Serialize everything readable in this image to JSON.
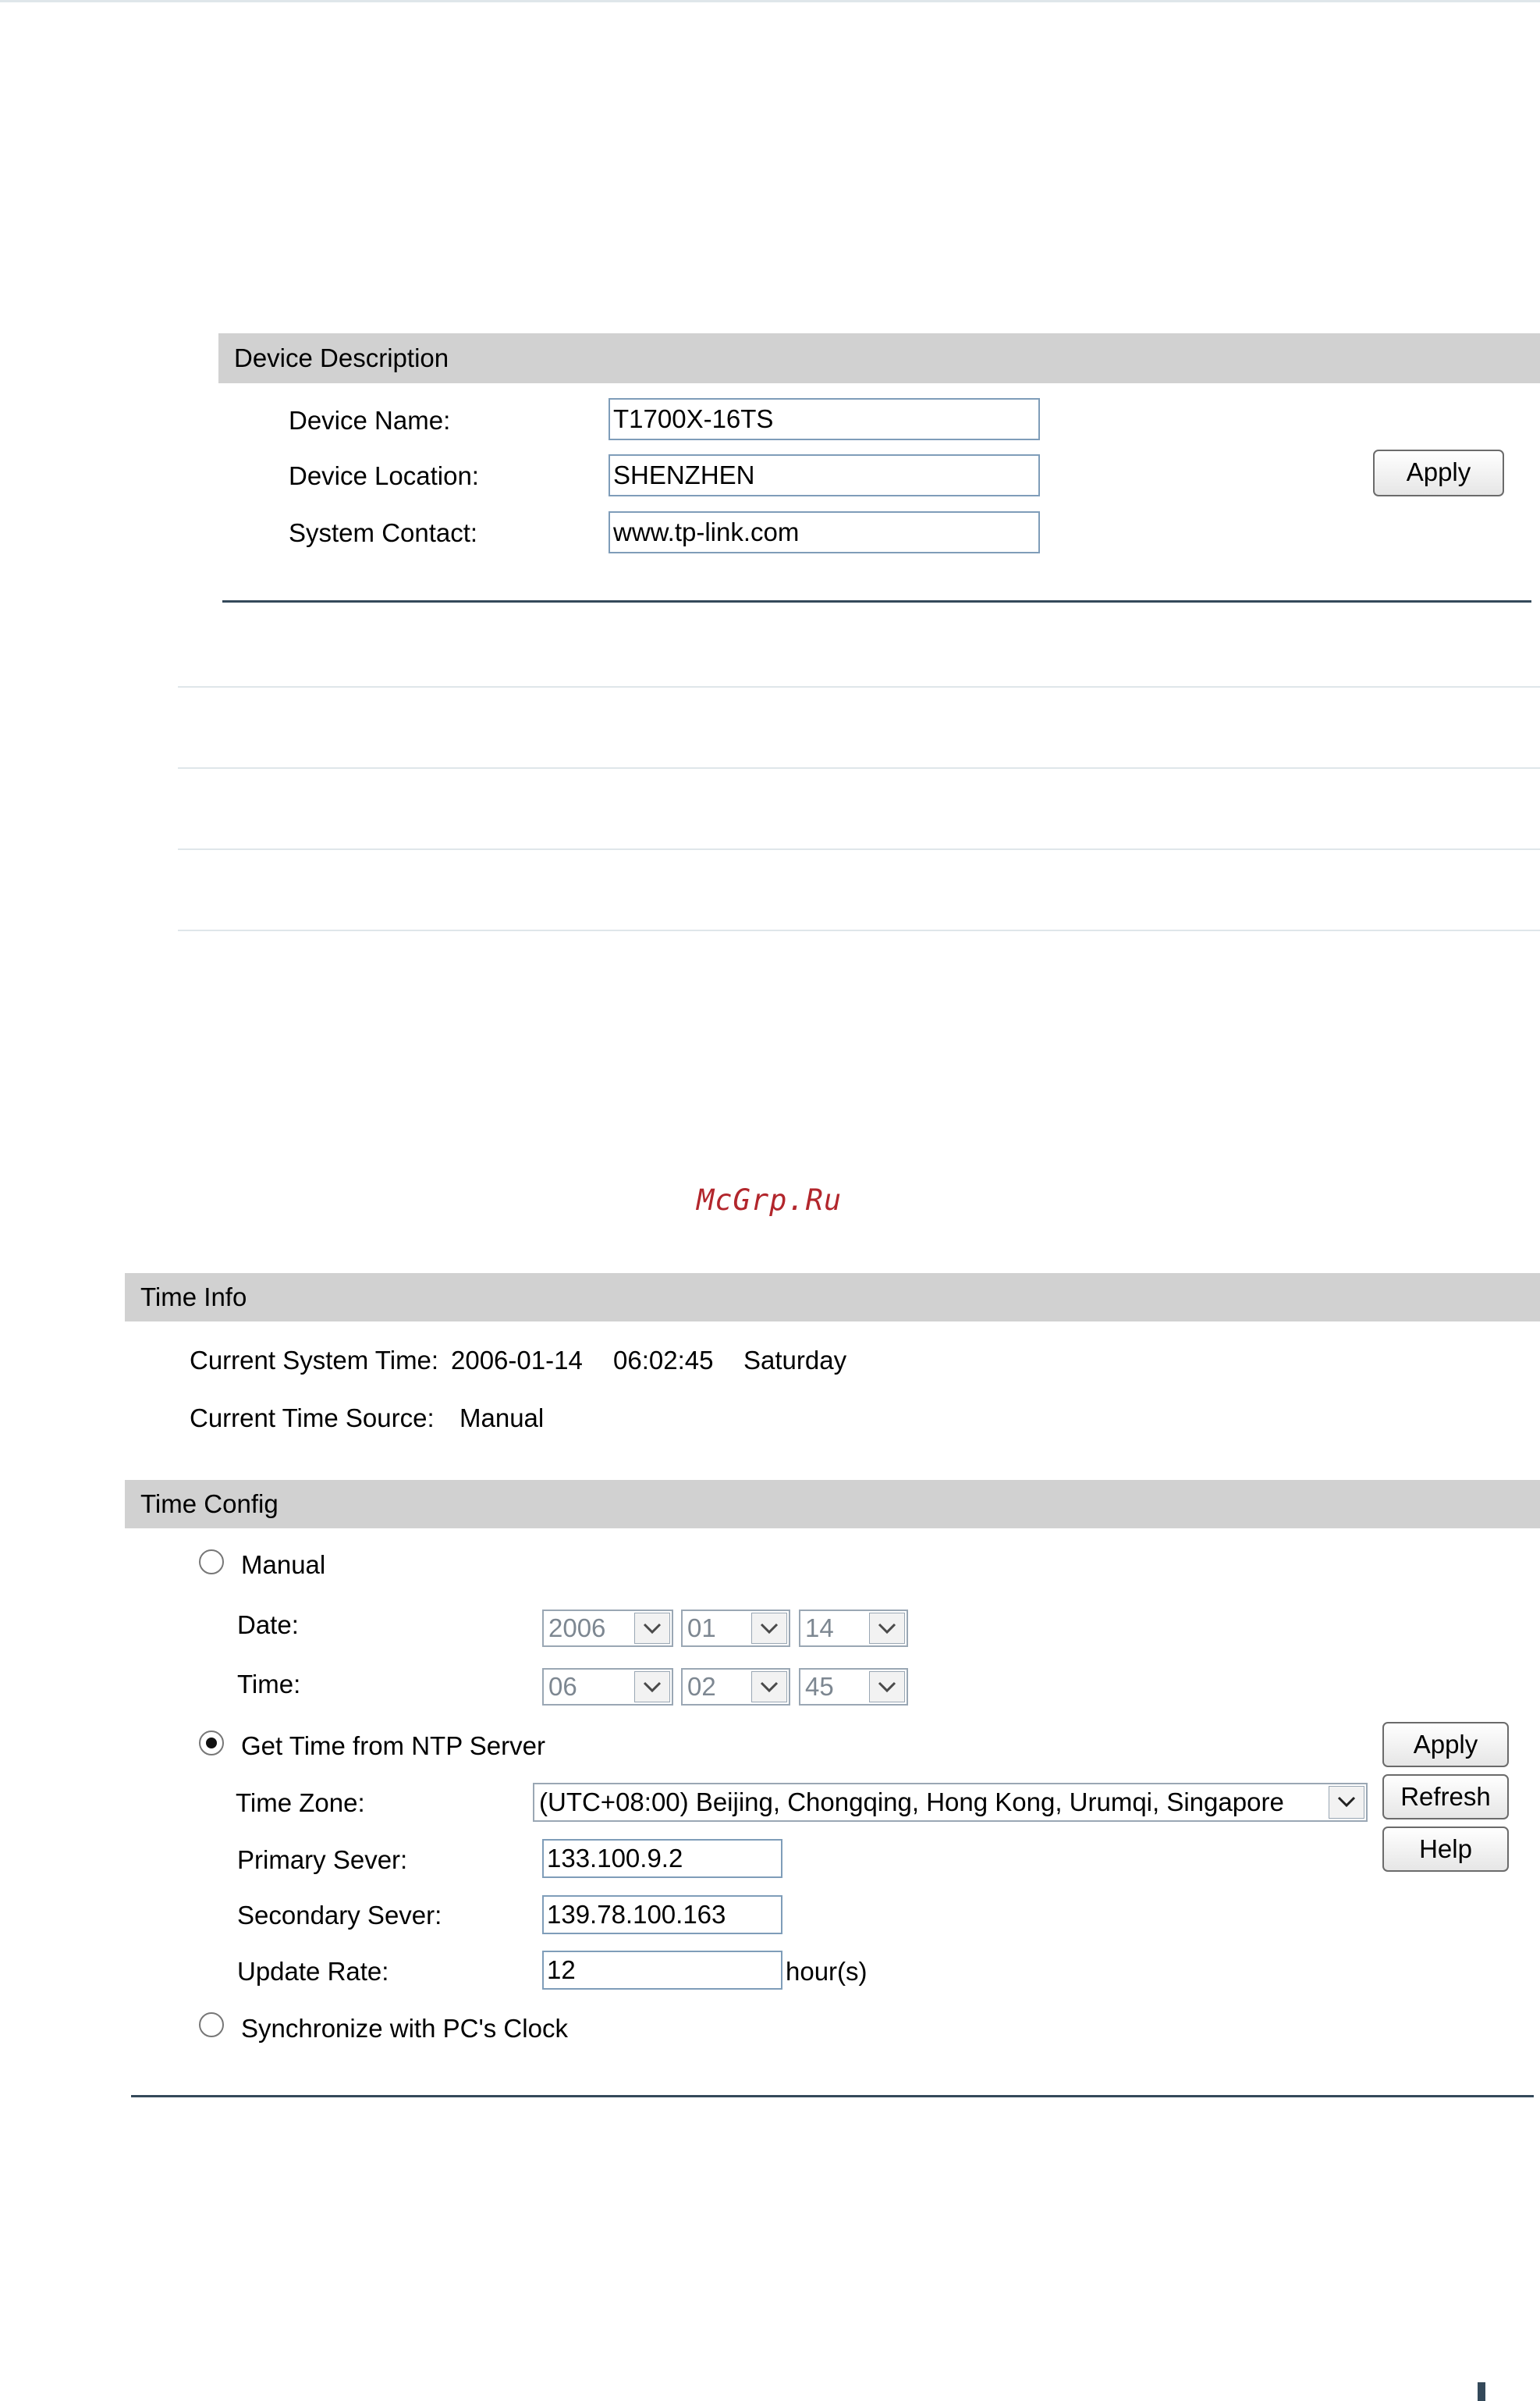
{
  "device_description": {
    "header": "Device Description",
    "device_name_label": "Device Name:",
    "device_name_value": "T1700X-16TS",
    "device_location_label": "Device Location:",
    "device_location_value": "SHENZHEN",
    "system_contact_label": "System Contact:",
    "system_contact_value": "www.tp-link.com",
    "apply_label": "Apply"
  },
  "watermark": "McGrp.Ru",
  "time_info": {
    "header": "Time Info",
    "current_time_label": "Current System Time:",
    "current_date": "2006-01-14",
    "current_time": "06:02:45",
    "current_day": "Saturday",
    "time_source_label": "Current Time Source:",
    "time_source_value": "Manual"
  },
  "time_config": {
    "header": "Time Config",
    "manual_label": "Manual",
    "manual_selected": false,
    "date_label": "Date:",
    "date_year": "2006",
    "date_month": "01",
    "date_day": "14",
    "time_label": "Time:",
    "time_hour": "06",
    "time_minute": "02",
    "time_second": "45",
    "ntp_label": "Get Time from NTP Server",
    "ntp_selected": true,
    "time_zone_label": "Time Zone:",
    "time_zone_value": "(UTC+08:00) Beijing, Chongqing, Hong Kong, Urumqi, Singapore",
    "primary_server_label": "Primary Sever:",
    "primary_server_value": "133.100.9.2",
    "secondary_server_label": "Secondary Sever:",
    "secondary_server_value": "139.78.100.163",
    "update_rate_label": "Update Rate:",
    "update_rate_value": "12",
    "update_rate_unit": "hour(s)",
    "sync_pc_label": "Synchronize with PC's Clock",
    "sync_pc_selected": false,
    "apply_label": "Apply",
    "refresh_label": "Refresh",
    "help_label": "Help"
  },
  "icons": {
    "dropdown": "chevron-down-icon",
    "radio": "radio-icon"
  }
}
